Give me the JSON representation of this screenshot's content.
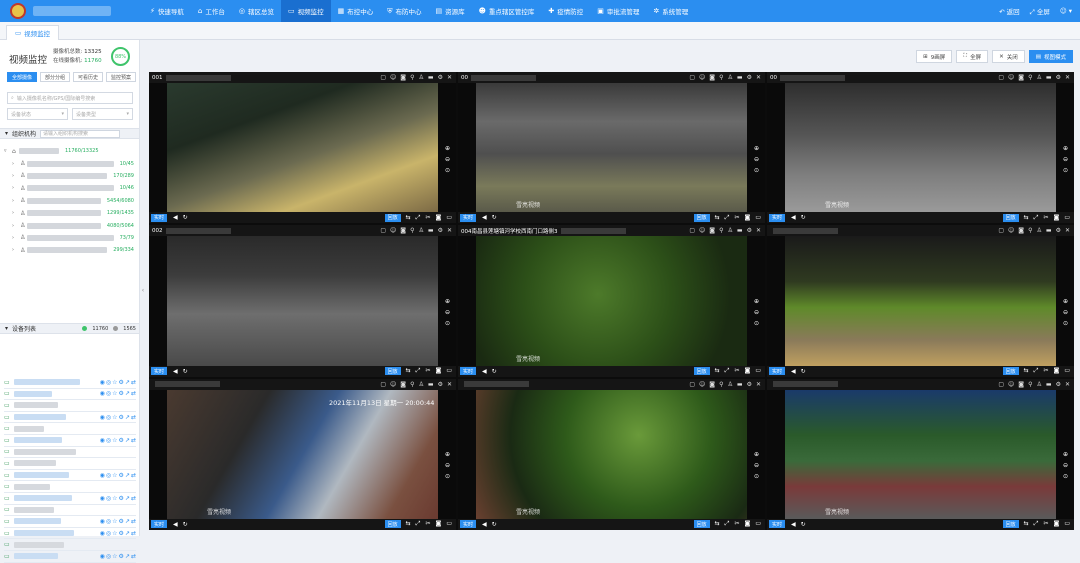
{
  "topbar": {
    "nav": [
      {
        "icon": "lightning-icon",
        "label": "快速导航"
      },
      {
        "icon": "home-icon",
        "label": "工作台"
      },
      {
        "icon": "compass-icon",
        "label": "辖区总览"
      },
      {
        "icon": "monitor-icon",
        "label": "视频监控",
        "active": true
      },
      {
        "icon": "grid-icon",
        "label": "布控中心"
      },
      {
        "icon": "shield-icon",
        "label": "布防中心"
      },
      {
        "icon": "database-icon",
        "label": "资源库"
      },
      {
        "icon": "person-icon",
        "label": "重点辖区管控库"
      },
      {
        "icon": "gear-icon",
        "label": "疫情防控"
      },
      {
        "icon": "doc-icon",
        "label": "审批流管理"
      },
      {
        "icon": "settings-icon",
        "label": "系统管理"
      }
    ],
    "right": [
      "返回",
      "全屏"
    ]
  },
  "tabbar": {
    "tab_label": "视频监控"
  },
  "sidebar": {
    "title": "视频监控",
    "stats": {
      "total_label": "摄像机总数:",
      "total": "13325",
      "online_label": "在线摄像机:",
      "online": "11760"
    },
    "ring": "88%",
    "buttons": [
      "全部摄像",
      "部分分组",
      "可看历史",
      "监控预案"
    ],
    "search_placeholder": "输入摄像机名称/GPS/国际编号搜索",
    "select1": "设备状态",
    "select2": "设备类型",
    "org_section": {
      "label": "组织机构",
      "placeholder": "请输入组织机构搜索"
    },
    "tree": [
      {
        "count": "11760/13325"
      },
      {
        "count": "10/45"
      },
      {
        "count": "170/289"
      },
      {
        "count": "10/46"
      },
      {
        "count": "5454/6080"
      },
      {
        "count": "1299/1435"
      },
      {
        "count": "4080/5064"
      },
      {
        "count": "73/79"
      },
      {
        "count": "299/334"
      }
    ],
    "device_section": {
      "label": "设备列表",
      "online": "11760",
      "offline": "1565"
    }
  },
  "toolbar": [
    "9画屏",
    "全屏",
    "关闭",
    "视图模式"
  ],
  "cells": [
    {
      "name": "001",
      "watermark": "",
      "ts": ""
    },
    {
      "name": "00",
      "watermark": "雪亮视频",
      "ts": ""
    },
    {
      "name": "00",
      "watermark": "雪亮视频",
      "ts": ""
    },
    {
      "name": "002",
      "watermark": "",
      "ts": ""
    },
    {
      "name": "004南昌县莲塘镇河学校西南门口路侧3",
      "watermark": "雪亮视频",
      "ts": ""
    },
    {
      "name": "",
      "watermark": "",
      "ts": ""
    },
    {
      "name": "",
      "watermark": "雪亮视频",
      "ts": "2021年11月13日 星期一 20:00:44"
    },
    {
      "name": "",
      "watermark": "雪亮视频",
      "ts": ""
    },
    {
      "name": "",
      "watermark": "雪亮视频",
      "ts": ""
    }
  ],
  "cell_controls": {
    "live": "实时",
    "replay": "回放"
  }
}
